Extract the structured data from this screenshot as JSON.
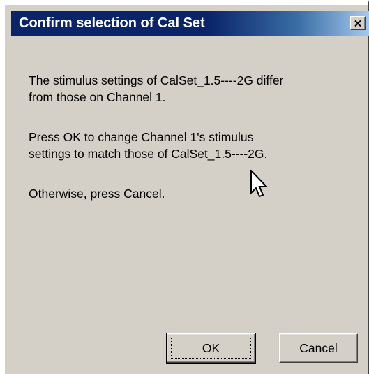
{
  "dialog": {
    "title": "Confirm selection of Cal Set",
    "close_icon": "close-x-icon",
    "message_lines": {
      "p1a": "The stimulus settings of CalSet_1.5----2G differ",
      "p1b": "from those on Channel 1.",
      "p2a": "Press OK to change Channel 1's stimulus",
      "p2b": "settings to match those of CalSet_1.5----2G.",
      "p3": "Otherwise, press Cancel."
    },
    "buttons": {
      "ok_label": "OK",
      "cancel_label": "Cancel"
    },
    "cursor_icon": "arrow-pointer-icon"
  },
  "colors": {
    "titlebar": "#0a246a",
    "titlebar_end": "#a6caf0",
    "face": "#d4d0c8",
    "title_text": "#ffffff"
  }
}
